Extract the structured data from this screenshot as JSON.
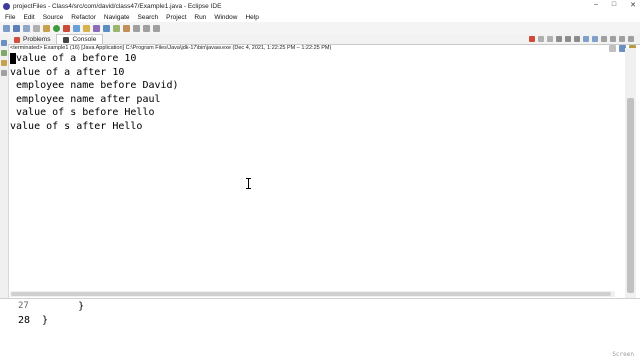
{
  "window": {
    "title": "projectFiles - Class4/src/com/david/class47/Example1.java - Eclipse IDE"
  },
  "menu": [
    "File",
    "Edit",
    "Source",
    "Refactor",
    "Navigate",
    "Search",
    "Project",
    "Run",
    "Window",
    "Help"
  ],
  "tabs": {
    "problems": "Problems",
    "console": "Console"
  },
  "console": {
    "status": "<terminated> Example1 (16) [Java Application] C:\\Program Files\\Java\\jdk-17\\bin\\javaw.exe  (Dec 4, 2021, 1:22:25 PM – 1:22:25 PM)",
    "lines": [
      "value of a before 10",
      "value of a after 10",
      " employee name before David)",
      " employee name after paul",
      " value of s before Hello",
      "value of s after Hello"
    ]
  },
  "editor": {
    "line27_num": "27",
    "line27_code": "       }",
    "line28_num": "28",
    "line28_code": " }"
  },
  "watermark": "Screen"
}
